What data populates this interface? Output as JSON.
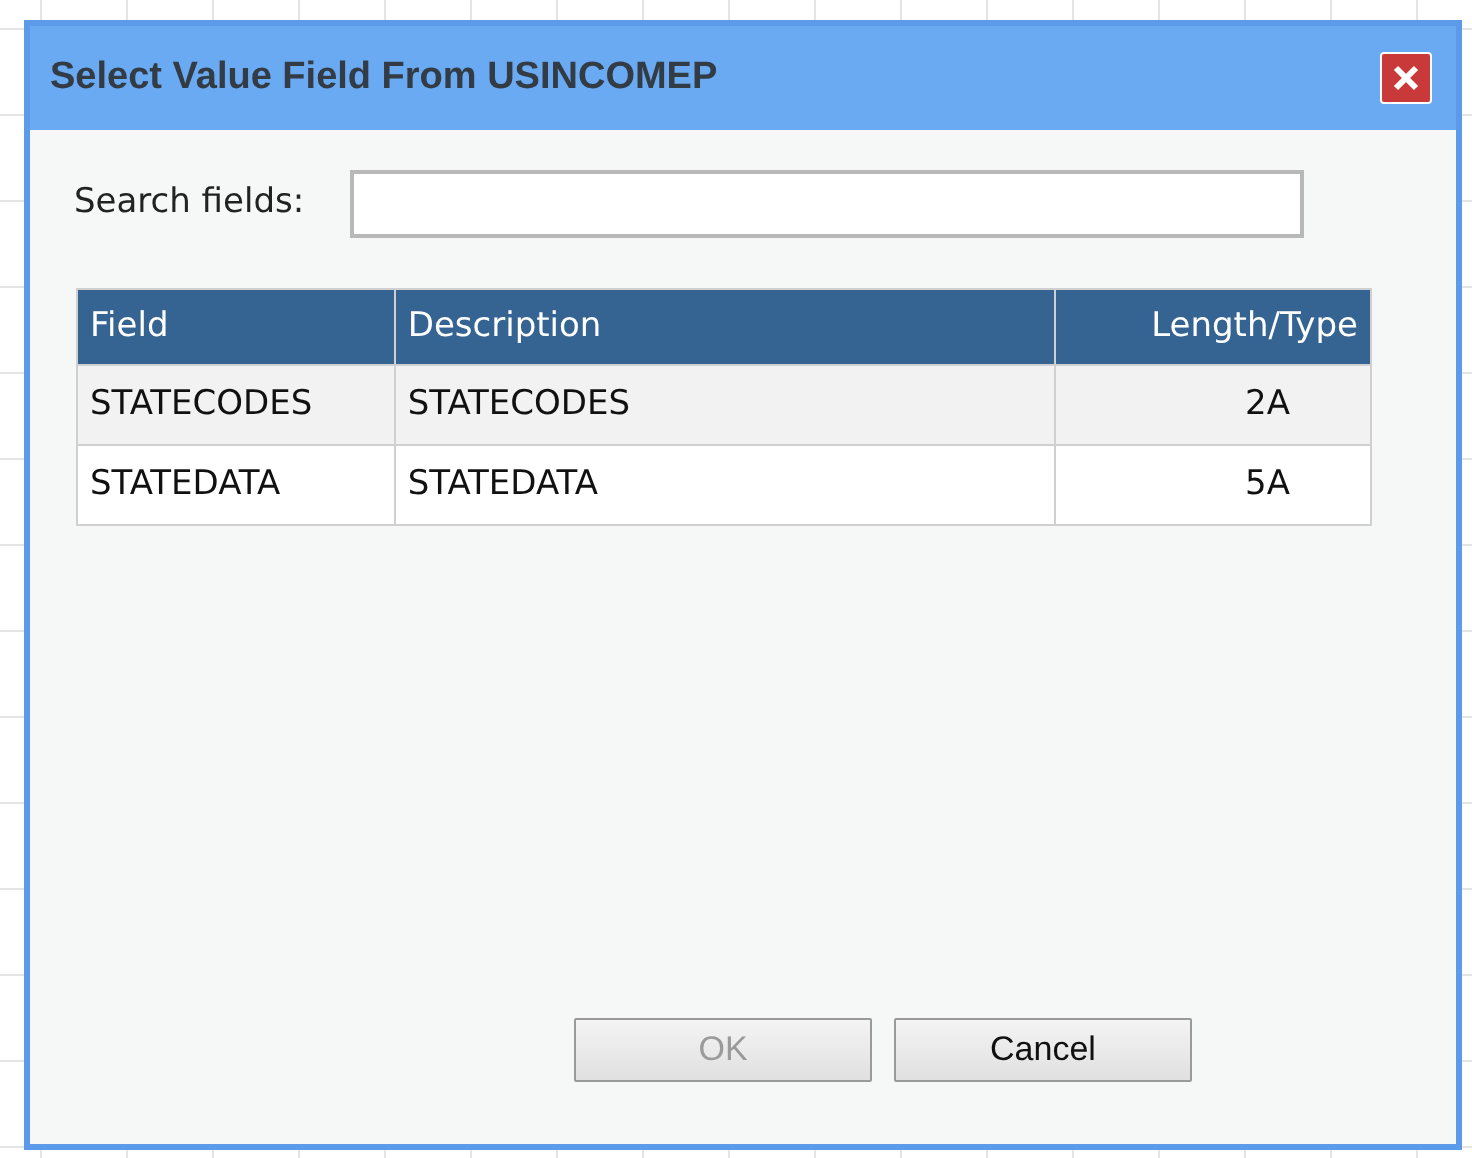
{
  "window": {
    "title": "Select Value Field From USINCOMEP"
  },
  "search": {
    "label": "Search fields:"
  },
  "table": {
    "columns": [
      "Field",
      "Description",
      "Length/Type"
    ],
    "rows": [
      [
        "STATECODES",
        "STATECODES",
        "2A"
      ],
      [
        "STATEDATA",
        "STATEDATA",
        "5A"
      ]
    ]
  },
  "buttons": [
    {
      "label": "OK",
      "disabled": true
    },
    {
      "label": "Cancel",
      "disabled": false
    }
  ]
}
